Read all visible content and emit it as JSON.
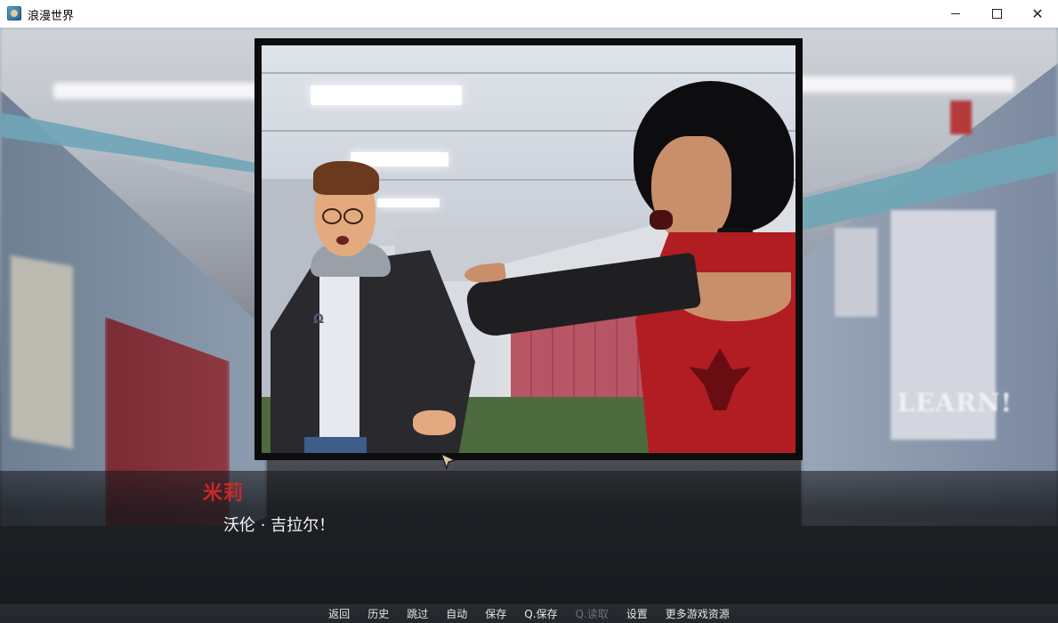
{
  "window": {
    "title": "浪漫世界",
    "icon": "game-app-icon",
    "controls": [
      "minimize-icon",
      "maximize-icon",
      "close-icon"
    ]
  },
  "scene": {
    "panel_image": "comic-panel-hallway-confrontation",
    "background_image": "blurred-school-hallway",
    "poster_text": "LEARN!"
  },
  "dialogue": {
    "speaker": "米莉",
    "speaker_color": "#c62a2a",
    "text": "沃伦 · 吉拉尔！"
  },
  "quick_menu": {
    "items": [
      {
        "label": "返回",
        "enabled": true
      },
      {
        "label": "历史",
        "enabled": true
      },
      {
        "label": "跳过",
        "enabled": true
      },
      {
        "label": "自动",
        "enabled": true
      },
      {
        "label": "保存",
        "enabled": true
      },
      {
        "label": "Q.保存",
        "enabled": true
      },
      {
        "label": "Q.读取",
        "enabled": false
      },
      {
        "label": "设置",
        "enabled": true
      },
      {
        "label": "更多游戏资源",
        "enabled": true
      }
    ]
  }
}
